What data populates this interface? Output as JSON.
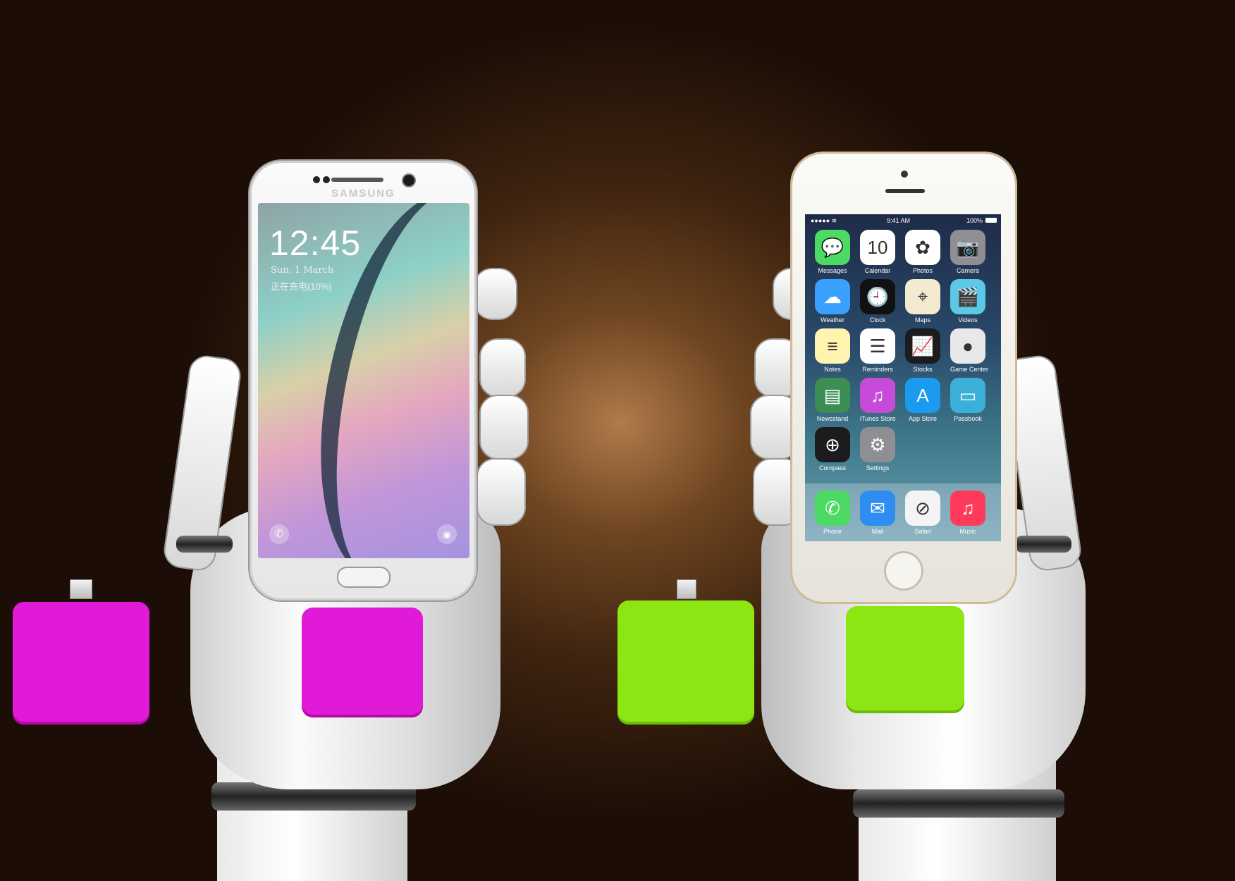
{
  "samsung": {
    "brand": "SAMSUNG",
    "time": "12:45",
    "date": "Sun, 1 March",
    "charging": "正在充电(10%)"
  },
  "iphone": {
    "status_time": "9:41 AM",
    "battery": "100%",
    "apps": [
      {
        "label": "Messages",
        "color": "#4cd964",
        "icon": "💬"
      },
      {
        "label": "Calendar",
        "color": "#ffffff",
        "icon": "10"
      },
      {
        "label": "Photos",
        "color": "#ffffff",
        "icon": "✿"
      },
      {
        "label": "Camera",
        "color": "#8e8e93",
        "icon": "📷"
      },
      {
        "label": "Weather",
        "color": "#3aa0ff",
        "icon": "☁"
      },
      {
        "label": "Clock",
        "color": "#111111",
        "icon": "🕘"
      },
      {
        "label": "Maps",
        "color": "#f3ead0",
        "icon": "⌖"
      },
      {
        "label": "Videos",
        "color": "#5bc8e8",
        "icon": "🎬"
      },
      {
        "label": "Notes",
        "color": "#fff3b0",
        "icon": "≡"
      },
      {
        "label": "Reminders",
        "color": "#ffffff",
        "icon": "☰"
      },
      {
        "label": "Stocks",
        "color": "#1c1c1e",
        "icon": "📈"
      },
      {
        "label": "Game Center",
        "color": "#e8e8e8",
        "icon": "●"
      },
      {
        "label": "Newsstand",
        "color": "#3b8f55",
        "icon": "▤"
      },
      {
        "label": "iTunes Store",
        "color": "#c54bd8",
        "icon": "♫"
      },
      {
        "label": "App Store",
        "color": "#1a9bf0",
        "icon": "A"
      },
      {
        "label": "Passbook",
        "color": "#3bb0d8",
        "icon": "▭"
      },
      {
        "label": "Compass",
        "color": "#1c1c1e",
        "icon": "⊕"
      },
      {
        "label": "Settings",
        "color": "#8e8e93",
        "icon": "⚙"
      }
    ],
    "dock": [
      {
        "label": "Phone",
        "color": "#4cd964",
        "icon": "✆"
      },
      {
        "label": "Mail",
        "color": "#2d8df0",
        "icon": "✉"
      },
      {
        "label": "Safari",
        "color": "#f4f4f4",
        "icon": "⊘"
      },
      {
        "label": "Music",
        "color": "#ff3b5c",
        "icon": "♫"
      }
    ]
  },
  "power_banks": {
    "left_color": "#e01ad6",
    "right_color": "#8ce614"
  }
}
